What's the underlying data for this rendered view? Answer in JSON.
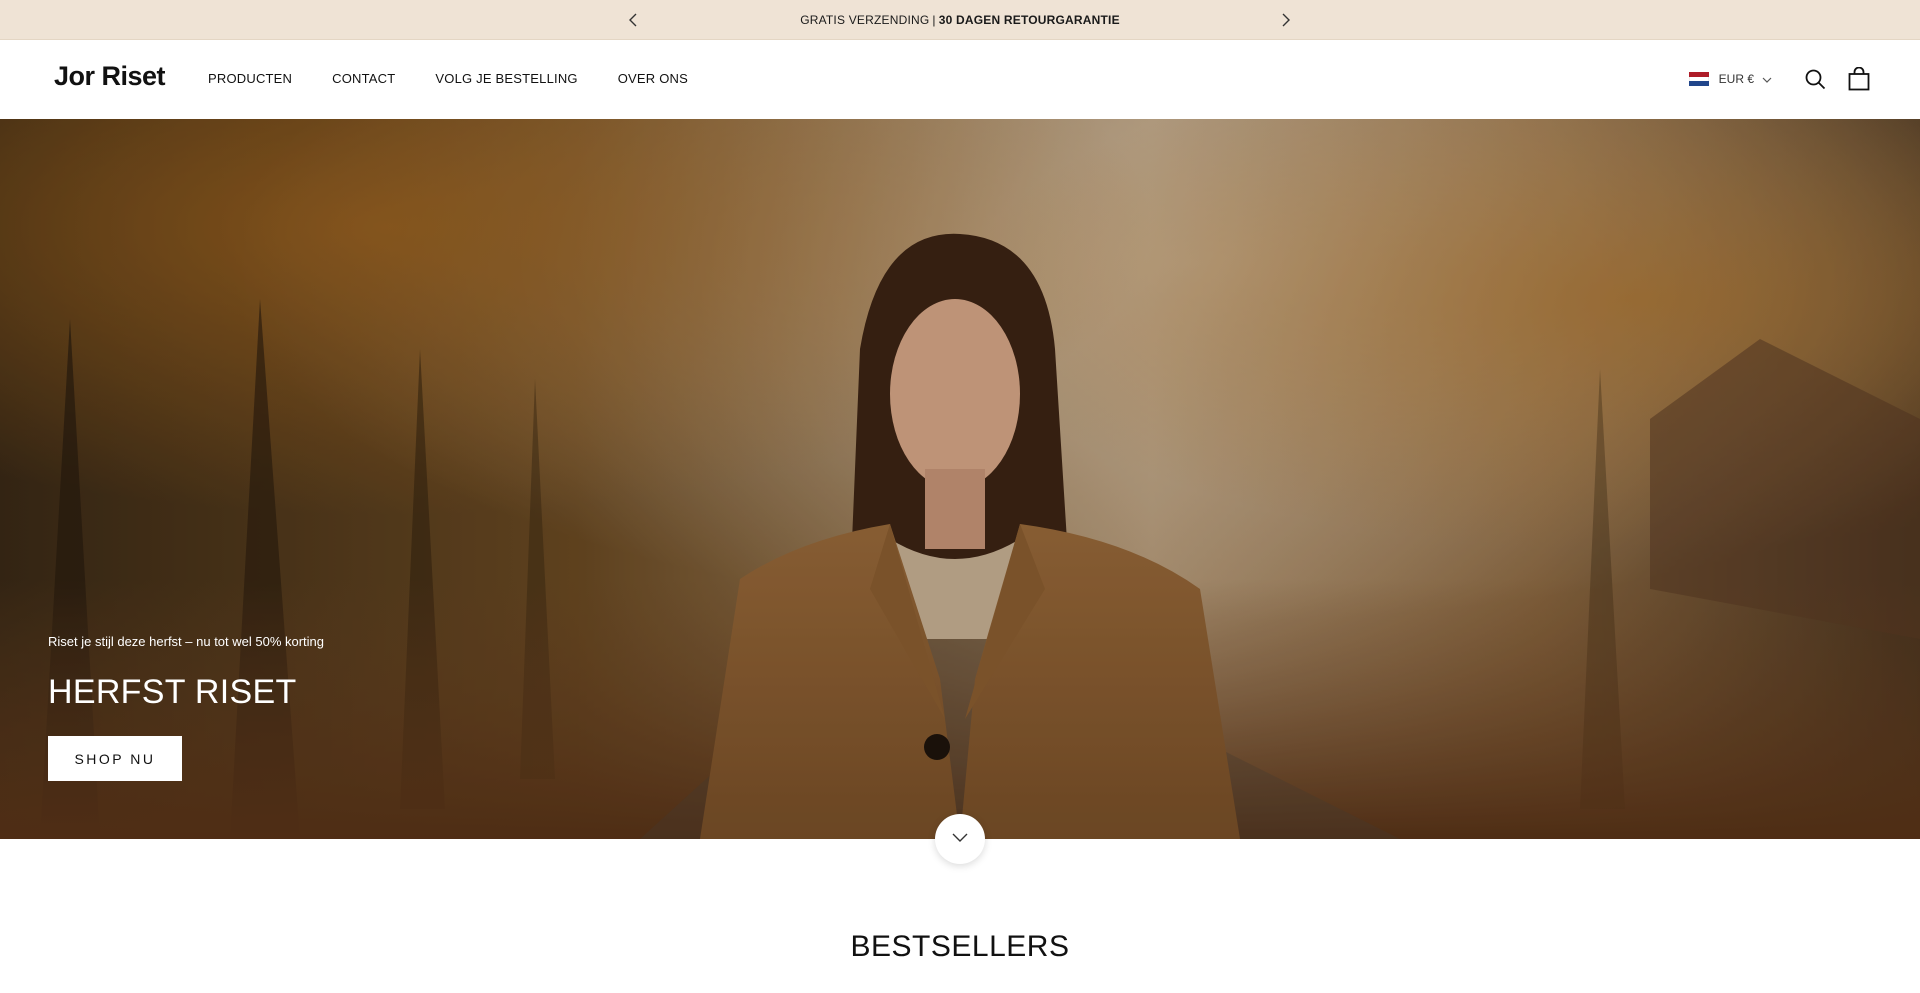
{
  "announcement": {
    "part1": "GRATIS VERZENDING",
    "separator": "|",
    "part2": "30 DAGEN RETOURGARANTIE",
    "prev_icon": "chevron-left-icon",
    "next_icon": "chevron-right-icon"
  },
  "header": {
    "logo": "Jor Riset",
    "nav": [
      {
        "label": "PRODUCTEN"
      },
      {
        "label": "CONTACT"
      },
      {
        "label": "VOLG JE BESTELLING"
      },
      {
        "label": "OVER ONS"
      }
    ],
    "currency": {
      "flag": "netherlands-flag-icon",
      "label": "EUR €",
      "chevron": "chevron-down-icon"
    },
    "search_icon": "search-icon",
    "cart_icon": "shopping-bag-icon"
  },
  "hero": {
    "subtitle": "Riset je stijl deze herfst – nu tot wel 50% korting",
    "title": "HERFST RISET",
    "cta_label": "SHOP NU",
    "scroll_icon": "chevron-down-icon"
  },
  "sections": {
    "bestsellers_title": "BESTSELLERS"
  },
  "colors": {
    "announcement_bg": "#efe3d5",
    "hero_tone": "#8a5a2b",
    "flag_red": "#ae1c28",
    "flag_white": "#ffffff",
    "flag_blue": "#21468b"
  }
}
